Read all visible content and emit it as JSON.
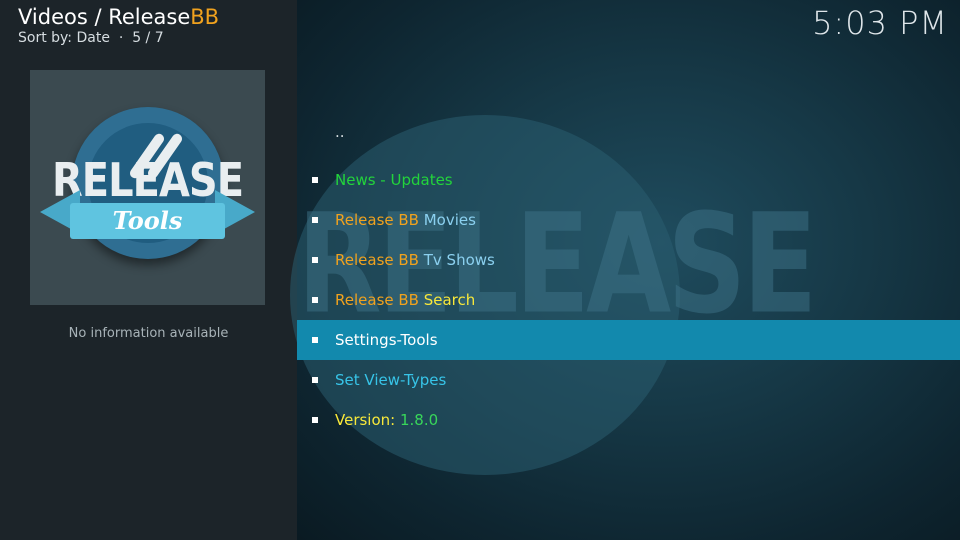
{
  "header": {
    "breadcrumb_prefix": "Videos / Release",
    "breadcrumb_accent": "BB",
    "sort_label": "Sort by: Date",
    "separator": "·",
    "position": "5 / 7"
  },
  "clock": "5:03 PM",
  "thumbnail": {
    "logo_word": "RELEASE",
    "ribbon_word": "Tools"
  },
  "info_text": "No information available",
  "background_watermark": "RELEASE",
  "list": {
    "parent": "..",
    "items": [
      {
        "parts": [
          {
            "text": "News - Updates",
            "color": "#22d43b"
          }
        ]
      },
      {
        "parts": [
          {
            "text": "Release BB ",
            "color": "#f0a21e"
          },
          {
            "text": "Movies",
            "color": "#8bd0ef"
          }
        ]
      },
      {
        "parts": [
          {
            "text": "Release BB ",
            "color": "#f0a21e"
          },
          {
            "text": "Tv Shows",
            "color": "#8bd0ef"
          }
        ]
      },
      {
        "parts": [
          {
            "text": "Release BB ",
            "color": "#f0a21e"
          },
          {
            "text": "Search",
            "color": "#f8e83a"
          }
        ]
      },
      {
        "parts": [
          {
            "text": "Settings-Tools",
            "color": "#ffffff"
          }
        ],
        "selected": true
      },
      {
        "parts": [
          {
            "text": "Set View-Types",
            "color": "#37c4e8"
          }
        ]
      },
      {
        "parts": [
          {
            "text": "Version: ",
            "color": "#f8e83a"
          },
          {
            "text": "1.8.0",
            "color": "#38d65a"
          }
        ]
      }
    ]
  },
  "colors": {
    "selection": "#1289ad",
    "accent": "#f0a21e",
    "left_panel": "#1c2429"
  }
}
